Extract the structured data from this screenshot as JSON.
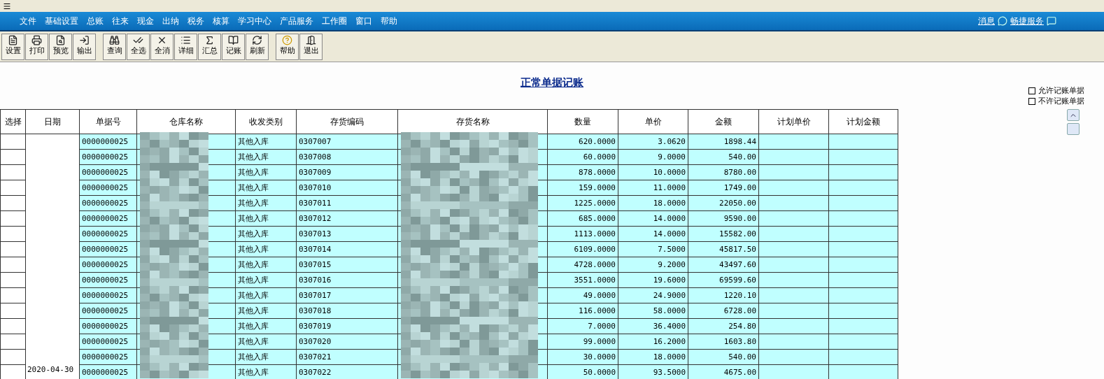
{
  "menu": [
    "文件",
    "基础设置",
    "总账",
    "往来",
    "现金",
    "出纳",
    "税务",
    "核算",
    "学习中心",
    "产品服务",
    "工作圈",
    "窗口",
    "帮助"
  ],
  "header_links": [
    "消息",
    "畅捷服务"
  ],
  "toolbar_groups": [
    [
      "设置",
      "打印",
      "预览",
      "输出"
    ],
    [
      "查询",
      "全选",
      "全消",
      "详细",
      "汇总",
      "记账",
      "刷新"
    ],
    [
      "帮助",
      "退出"
    ]
  ],
  "title": "正常单据记账",
  "options": [
    {
      "label": "允许记账单据",
      "checked": false
    },
    {
      "label": "不许记账单据",
      "checked": false
    }
  ],
  "table": {
    "columns": [
      "选择",
      "日期",
      "单据号",
      "仓库名称",
      "收发类别",
      "存货编码",
      "存货名称",
      "数量",
      "单价",
      "金额",
      "计划单价",
      "计划金额"
    ],
    "date": "2020-04-30",
    "rows": [
      {
        "doc": "0000000025",
        "type": "其他入库",
        "code": "0307007",
        "qty": "620.0000",
        "price": "3.0620",
        "amount": "1898.44"
      },
      {
        "doc": "0000000025",
        "type": "其他入库",
        "code": "0307008",
        "qty": "60.0000",
        "price": "9.0000",
        "amount": "540.00"
      },
      {
        "doc": "0000000025",
        "type": "其他入库",
        "code": "0307009",
        "qty": "878.0000",
        "price": "10.0000",
        "amount": "8780.00"
      },
      {
        "doc": "0000000025",
        "type": "其他入库",
        "code": "0307010",
        "qty": "159.0000",
        "price": "11.0000",
        "amount": "1749.00"
      },
      {
        "doc": "0000000025",
        "type": "其他入库",
        "code": "0307011",
        "qty": "1225.0000",
        "price": "18.0000",
        "amount": "22050.00"
      },
      {
        "doc": "0000000025",
        "type": "其他入库",
        "code": "0307012",
        "qty": "685.0000",
        "price": "14.0000",
        "amount": "9590.00"
      },
      {
        "doc": "0000000025",
        "type": "其他入库",
        "code": "0307013",
        "qty": "1113.0000",
        "price": "14.0000",
        "amount": "15582.00"
      },
      {
        "doc": "0000000025",
        "type": "其他入库",
        "code": "0307014",
        "qty": "6109.0000",
        "price": "7.5000",
        "amount": "45817.50"
      },
      {
        "doc": "0000000025",
        "type": "其他入库",
        "code": "0307015",
        "qty": "4728.0000",
        "price": "9.2000",
        "amount": "43497.60"
      },
      {
        "doc": "0000000025",
        "type": "其他入库",
        "code": "0307016",
        "qty": "3551.0000",
        "price": "19.6000",
        "amount": "69599.60"
      },
      {
        "doc": "0000000025",
        "type": "其他入库",
        "code": "0307017",
        "qty": "49.0000",
        "price": "24.9000",
        "amount": "1220.10"
      },
      {
        "doc": "0000000025",
        "type": "其他入库",
        "code": "0307018",
        "qty": "116.0000",
        "price": "58.0000",
        "amount": "6728.00"
      },
      {
        "doc": "0000000025",
        "type": "其他入库",
        "code": "0307019",
        "qty": "7.0000",
        "price": "36.4000",
        "amount": "254.80"
      },
      {
        "doc": "0000000025",
        "type": "其他入库",
        "code": "0307020",
        "qty": "99.0000",
        "price": "16.2000",
        "amount": "1603.80"
      },
      {
        "doc": "0000000025",
        "type": "其他入库",
        "code": "0307021",
        "qty": "30.0000",
        "price": "18.0000",
        "amount": "540.00"
      },
      {
        "doc": "0000000025",
        "type": "其他入库",
        "code": "0307022",
        "qty": "50.0000",
        "price": "93.5000",
        "amount": "4675.00"
      }
    ]
  }
}
